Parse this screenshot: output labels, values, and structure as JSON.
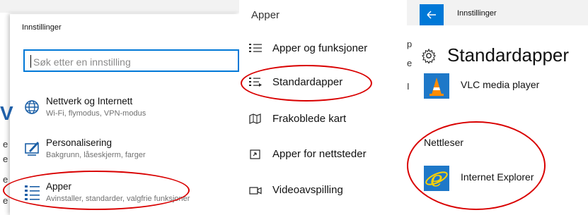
{
  "panel_settings": {
    "window_title": "Innstillinger",
    "search": {
      "placeholder": "Søk etter en innstilling"
    },
    "categories": [
      {
        "label": "Nettverk og Internett",
        "sub": "Wi-Fi, flymodus, VPN-modus",
        "icon": "globe-icon"
      },
      {
        "label": "Personalisering",
        "sub": "Bakgrunn, låseskjerm, farger",
        "icon": "personalize-icon"
      },
      {
        "label": "Apper",
        "sub": "Avinstaller, standarder, valgfrie funksjoner",
        "icon": "apps-list-icon"
      }
    ],
    "edge_glyph": "V",
    "edge_letters": [
      "e",
      "e",
      "e",
      "e"
    ]
  },
  "panel_apper": {
    "heading": "Apper",
    "items": [
      {
        "label": "Apper og funksjoner",
        "icon": "apps-features-icon"
      },
      {
        "label": "Standardapper",
        "icon": "default-apps-icon"
      },
      {
        "label": "Frakoblede kart",
        "icon": "offline-maps-icon"
      },
      {
        "label": "Apper for nettsteder",
        "icon": "apps-websites-icon"
      },
      {
        "label": "Videoavspilling",
        "icon": "video-playback-icon"
      }
    ]
  },
  "panel_standard": {
    "window_title": "Innstillinger",
    "page_title": "Standardapper",
    "video_app": {
      "label": "VLC media player",
      "icon": "vlc-icon"
    },
    "section_label": "Nettleser",
    "browser_app": {
      "label": "Internet Explorer",
      "icon": "internet-explorer-icon"
    },
    "side_letters": [
      "p",
      "e",
      "I"
    ]
  },
  "annotation_color": "#d90000",
  "accent_color": "#0078d7"
}
